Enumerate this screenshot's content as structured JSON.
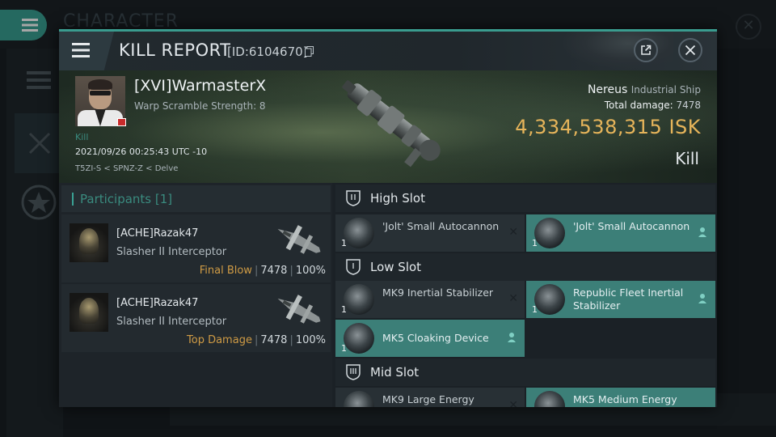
{
  "background": {
    "title": "CHARACTER",
    "close_label": "✕"
  },
  "header": {
    "title": "KILL REPORT",
    "id_text": "[ID:6104670]"
  },
  "victim": {
    "name": "[XVI]WarmasterX",
    "warp_scramble": "Warp Scramble Strength: 8",
    "tag": "Kill",
    "datetime": "2021/09/26 00:25:43 UTC -10",
    "location": "T5ZI-S < SPNZ-Z < Delve",
    "ship_name": "Nereus",
    "ship_class": "Industrial Ship",
    "total_damage_label": "Total damage:",
    "total_damage": "7478",
    "isk_value": "4,334,538,315",
    "isk_unit": "ISK",
    "result": "Kill"
  },
  "participants": {
    "header": "Participants",
    "count": "[1]",
    "rows": [
      {
        "name": "[ACHE]Razak47",
        "ship": "Slasher II Interceptor",
        "label": "Final Blow",
        "damage": "7478",
        "percent": "100%"
      },
      {
        "name": "[ACHE]Razak47",
        "ship": "Slasher II Interceptor",
        "label": "Top Damage",
        "damage": "7478",
        "percent": "100%"
      }
    ]
  },
  "fitting": {
    "high": {
      "label": "High Slot",
      "modules": [
        {
          "qty": "1",
          "name": "'Jolt' Small Autocannon",
          "state": "destroyed"
        },
        {
          "qty": "1",
          "name": "'Jolt' Small Autocannon",
          "state": "dropped"
        }
      ]
    },
    "low": {
      "label": "Low Slot",
      "modules": [
        {
          "qty": "1",
          "name": "MK9 Inertial Stabilizer",
          "state": "destroyed"
        },
        {
          "qty": "1",
          "name": "Republic Fleet Inertial Stabilizer",
          "state": "dropped"
        },
        {
          "qty": "1",
          "name": "MK5 Cloaking Device",
          "state": "dropped"
        }
      ]
    },
    "mid": {
      "label": "Mid Slot",
      "modules": [
        {
          "qty": "",
          "name": "MK9 Large Energy",
          "state": "destroyed"
        },
        {
          "qty": "",
          "name": "MK5 Medium Energy",
          "state": "dropped"
        }
      ]
    }
  },
  "colors": {
    "accent": "#3aa294",
    "isk": "#e6b45a",
    "final_blow": "#cf9b45",
    "dropped_module": "#3c7f78"
  }
}
